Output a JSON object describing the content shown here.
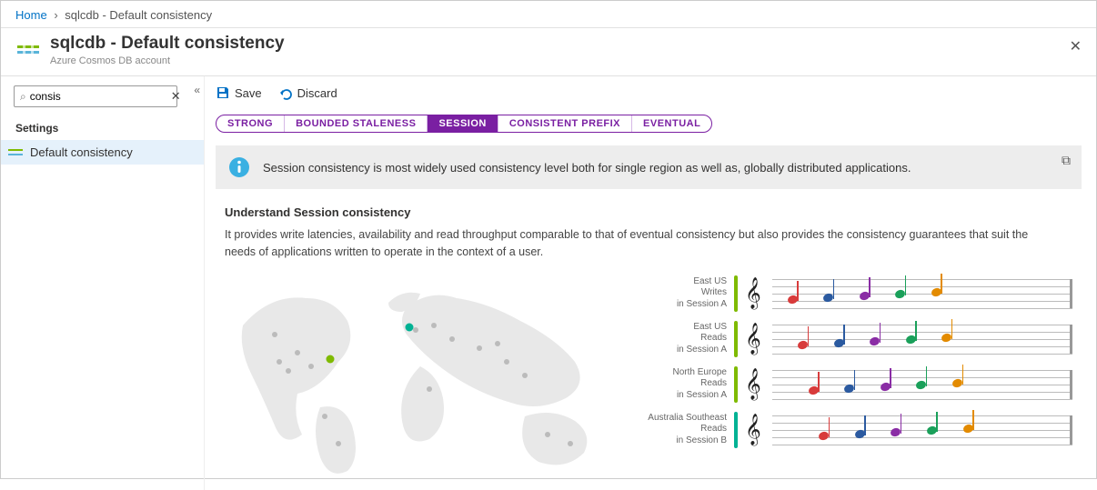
{
  "breadcrumb": {
    "home": "Home",
    "current": "sqlcdb - Default consistency"
  },
  "blade": {
    "title": "sqlcdb - Default consistency",
    "subtitle": "Azure Cosmos DB account"
  },
  "sidebar": {
    "search_value": "consis",
    "search_placeholder": "Search",
    "section_title": "Settings",
    "items": [
      {
        "label": "Default consistency",
        "active": true
      }
    ]
  },
  "toolbar": {
    "save": "Save",
    "discard": "Discard"
  },
  "pills": {
    "items": [
      "STRONG",
      "BOUNDED STALENESS",
      "SESSION",
      "CONSISTENT PREFIX",
      "EVENTUAL"
    ],
    "active_index": 2
  },
  "info": {
    "text": "Session consistency is most widely used consistency level both for single region as well as, globally distributed applications."
  },
  "content": {
    "heading": "Understand Session consistency",
    "body": "It provides write latencies, availability and read throughput comparable to that of eventual consistency but also provides the consistency guarantees that suit the needs of applications written to operate in the context of a user."
  },
  "staves": {
    "rows": [
      {
        "region": "East US",
        "op": "Writes",
        "session": "in Session A",
        "bar_color": "#7fba00"
      },
      {
        "region": "East US",
        "op": "Reads",
        "session": "in Session A",
        "bar_color": "#7fba00"
      },
      {
        "region": "North Europe",
        "op": "Reads",
        "session": "in Session A",
        "bar_color": "#7fba00"
      },
      {
        "region": "Australia Southeast",
        "op": "Reads",
        "session": "in Session B",
        "bar_color": "#00b294"
      }
    ],
    "note_colors": [
      "#d83b3b",
      "#2b5aa0",
      "#8a2da5",
      "#1aa05a",
      "#e38b00"
    ],
    "note_base_positions": [
      5,
      17,
      29,
      41,
      53
    ]
  },
  "colors": {
    "accent": "#0072c6",
    "purple": "#7a1fa2"
  }
}
